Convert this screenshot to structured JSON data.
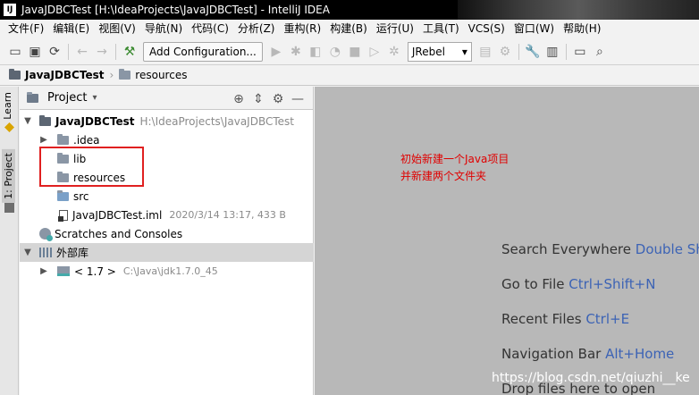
{
  "window": {
    "title": "JavaJDBCTest [H:\\IdeaProjects\\JavaJDBCTest] - IntelliJ IDEA",
    "app_icon": "IJ"
  },
  "menu": [
    "文件(F)",
    "编辑(E)",
    "视图(V)",
    "导航(N)",
    "代码(C)",
    "分析(Z)",
    "重构(R)",
    "构建(B)",
    "运行(U)",
    "工具(T)",
    "VCS(S)",
    "窗口(W)",
    "帮助(H)"
  ],
  "toolbar": {
    "add_config_label": "Add Configuration...",
    "jrebel_label": "JRebel"
  },
  "breadcrumb": [
    "JavaJDBCTest",
    "resources"
  ],
  "stripe": {
    "learn_label": "Learn",
    "project_label": "1: Project"
  },
  "project_panel": {
    "title": "Project",
    "tree": {
      "root_name": "JavaJDBCTest",
      "root_path": "H:\\IdeaProjects\\JavaJDBCTest",
      "idea": ".idea",
      "lib": "lib",
      "resources": "resources",
      "src": "src",
      "iml_name": "JavaJDBCTest.iml",
      "iml_meta": "2020/3/14 13:17, 433 B",
      "scratches": "Scratches and Consoles",
      "external_libs": "外部库",
      "jdk_name": "< 1.7 >",
      "jdk_path": "C:\\Java\\jdk1.7.0_45"
    }
  },
  "annotation": {
    "line1": "初始新建一个Java项目",
    "line2": "并新建两个文件夹"
  },
  "editor_hints": [
    {
      "text": "Search Everywhere",
      "key": "Double Sh"
    },
    {
      "text": "Go to File",
      "key": "Ctrl+Shift+N"
    },
    {
      "text": "Recent Files",
      "key": "Ctrl+E"
    },
    {
      "text": "Navigation Bar",
      "key": "Alt+Home"
    },
    {
      "text": "Drop files here to open",
      "key": ""
    }
  ],
  "watermark": "https://blog.csdn.net/qiuzhi__ke",
  "colors": {
    "editor_bg": "#b8b8b8",
    "annotation_red": "#e00000",
    "hint_key_blue": "#3c63b5",
    "redbox_border": "#e02020"
  }
}
